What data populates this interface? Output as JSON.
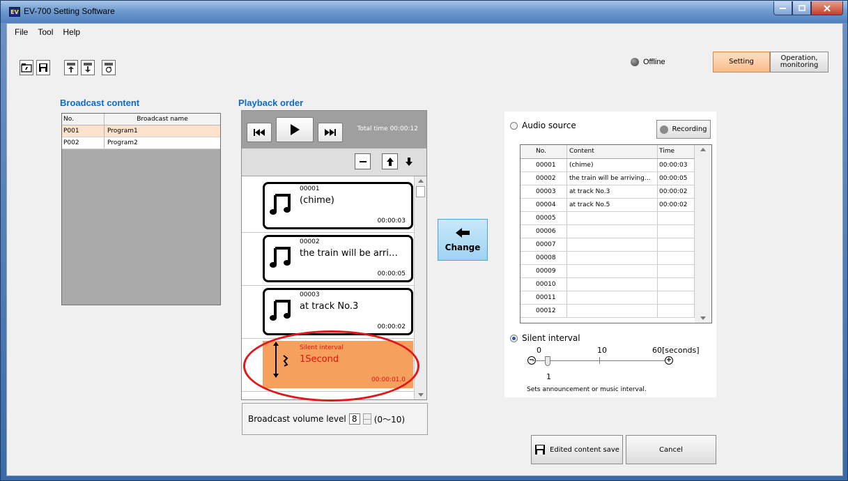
{
  "window": {
    "title": "EV-700 Setting Software",
    "app_icon_text": "EV"
  },
  "menu": [
    "File",
    "Tool",
    "Help"
  ],
  "toolbar": {
    "icons": [
      "folder-open-icon",
      "save-icon",
      "upload-icon",
      "download-icon",
      "refresh-icon"
    ]
  },
  "status": {
    "connection": "Offline"
  },
  "mode": {
    "setting": "Setting",
    "operation": "Operation,\nmonitoring",
    "active": "setting"
  },
  "broadcast_content": {
    "title": "Broadcast content",
    "headers": [
      "No.",
      "Broadcast name"
    ],
    "rows": [
      {
        "no": "P001",
        "name": "Program1",
        "selected": true
      },
      {
        "no": "P002",
        "name": "Program2",
        "selected": false
      }
    ]
  },
  "playback": {
    "title": "Playback order",
    "total_time": "Total time  00:00:12",
    "items": [
      {
        "num": "00001",
        "title": "(chime)",
        "time": "00:00:03"
      },
      {
        "num": "00002",
        "title": "the train will be arri…",
        "time": "00:00:05"
      },
      {
        "num": "00003",
        "title": "at track No.3",
        "time": "00:00:02"
      },
      {
        "num": "Silent interval",
        "title": "1Second",
        "time": "00:00:01.0"
      }
    ]
  },
  "change_label": "Change",
  "volume": {
    "label": "Broadcast volume level",
    "value": "8",
    "range": "(0～10)"
  },
  "audio_source": {
    "label": "Audio source",
    "recording": "Recording",
    "headers": [
      "No.",
      "Content",
      "Time"
    ],
    "rows": [
      [
        "00001",
        "(chime)",
        "00:00:03"
      ],
      [
        "00002",
        "the train will be arriving…",
        "00:00:05"
      ],
      [
        "00003",
        "at track No.3",
        "00:00:02"
      ],
      [
        "00004",
        "at track No.5",
        "00:00:02"
      ],
      [
        "00005",
        "",
        ""
      ],
      [
        "00006",
        "",
        ""
      ],
      [
        "00007",
        "",
        ""
      ],
      [
        "00008",
        "",
        ""
      ],
      [
        "00009",
        "",
        ""
      ],
      [
        "00010",
        "",
        ""
      ],
      [
        "00011",
        "",
        ""
      ],
      [
        "00012",
        "",
        ""
      ]
    ]
  },
  "silent": {
    "label": "Silent interval",
    "scale_min": "0",
    "scale_mid": "10",
    "scale_max": "60[seconds]",
    "value": "1",
    "hint": "Sets announcement or music interval."
  },
  "buttons": {
    "save": "Edited content save",
    "cancel": "Cancel"
  },
  "colors": {
    "accent_blue": "#0a6ccf",
    "selected_row": "#fde3cd",
    "silent_card": "#f5a15d",
    "highlight_red": "#e3161b"
  }
}
